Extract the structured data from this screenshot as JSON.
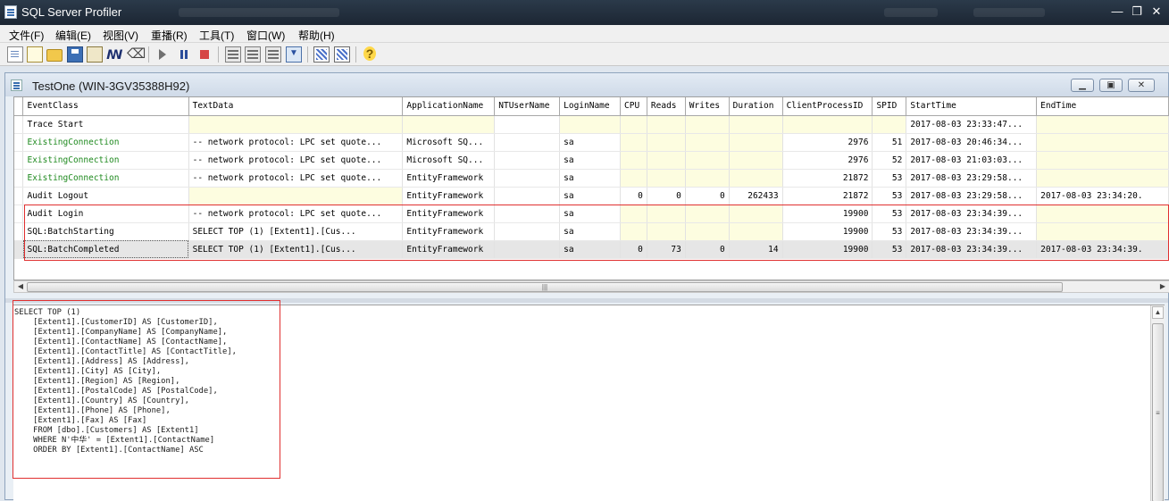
{
  "window": {
    "title": "SQL Server Profiler"
  },
  "menu": [
    "文件(F)",
    "编辑(E)",
    "视图(V)",
    "重播(R)",
    "工具(T)",
    "窗口(W)",
    "帮助(H)"
  ],
  "toolbar": {
    "buttons": [
      "new-trace-icon",
      "new-template-icon",
      "open-folder-icon",
      "save-icon",
      "properties-icon",
      "find-icon",
      "clear-icon",
      "start-icon",
      "pause-icon",
      "stop-icon",
      "grid-icon",
      "grid2-icon",
      "columns-icon",
      "auto-scroll-icon",
      "perfmon-icon",
      "chart-icon",
      "help-icon"
    ]
  },
  "trace_window": {
    "title": "TestOne (WIN-3GV35388H92)",
    "columns": [
      "EventClass",
      "TextData",
      "ApplicationName",
      "NTUserName",
      "LoginName",
      "CPU",
      "Reads",
      "Writes",
      "Duration",
      "ClientProcessID",
      "SPID",
      "StartTime",
      "EndTime"
    ],
    "rows": [
      {
        "EventClass": "Trace Start",
        "TextData": "",
        "ApplicationName": "",
        "NTUserName": "",
        "LoginName": "",
        "CPU": "",
        "Reads": "",
        "Writes": "",
        "Duration": "",
        "ClientProcessID": "",
        "SPID": "",
        "StartTime": "2017-08-03 23:33:47...",
        "EndTime": "",
        "green": false
      },
      {
        "EventClass": "ExistingConnection",
        "TextData": "-- network protocol: LPC  set quote...",
        "ApplicationName": "Microsoft SQ...",
        "NTUserName": "",
        "LoginName": "sa",
        "CPU": "",
        "Reads": "",
        "Writes": "",
        "Duration": "",
        "ClientProcessID": "2976",
        "SPID": "51",
        "StartTime": "2017-08-03 20:46:34...",
        "EndTime": "",
        "green": true
      },
      {
        "EventClass": "ExistingConnection",
        "TextData": "-- network protocol: LPC  set quote...",
        "ApplicationName": "Microsoft SQ...",
        "NTUserName": "",
        "LoginName": "sa",
        "CPU": "",
        "Reads": "",
        "Writes": "",
        "Duration": "",
        "ClientProcessID": "2976",
        "SPID": "52",
        "StartTime": "2017-08-03 21:03:03...",
        "EndTime": "",
        "green": true
      },
      {
        "EventClass": "ExistingConnection",
        "TextData": "-- network protocol: LPC  set quote...",
        "ApplicationName": "EntityFramework",
        "NTUserName": "",
        "LoginName": "sa",
        "CPU": "",
        "Reads": "",
        "Writes": "",
        "Duration": "",
        "ClientProcessID": "21872",
        "SPID": "53",
        "StartTime": "2017-08-03 23:29:58...",
        "EndTime": "",
        "green": true
      },
      {
        "EventClass": "Audit Logout",
        "TextData": "",
        "ApplicationName": "EntityFramework",
        "NTUserName": "",
        "LoginName": "sa",
        "CPU": "0",
        "Reads": "0",
        "Writes": "0",
        "Duration": "262433",
        "ClientProcessID": "21872",
        "SPID": "53",
        "StartTime": "2017-08-03 23:29:58...",
        "EndTime": "2017-08-03 23:34:20.",
        "green": false
      },
      {
        "EventClass": "Audit Login",
        "TextData": "-- network protocol: LPC  set quote...",
        "ApplicationName": "EntityFramework",
        "NTUserName": "",
        "LoginName": "sa",
        "CPU": "",
        "Reads": "",
        "Writes": "",
        "Duration": "",
        "ClientProcessID": "19900",
        "SPID": "53",
        "StartTime": "2017-08-03 23:34:39...",
        "EndTime": "",
        "green": false
      },
      {
        "EventClass": "SQL:BatchStarting",
        "TextData": "SELECT TOP (1)       [Extent1].[Cus...",
        "ApplicationName": "EntityFramework",
        "NTUserName": "",
        "LoginName": "sa",
        "CPU": "",
        "Reads": "",
        "Writes": "",
        "Duration": "",
        "ClientProcessID": "19900",
        "SPID": "53",
        "StartTime": "2017-08-03 23:34:39...",
        "EndTime": "",
        "green": false
      },
      {
        "EventClass": "SQL:BatchCompleted",
        "TextData": "SELECT TOP (1)       [Extent1].[Cus...",
        "ApplicationName": "EntityFramework",
        "NTUserName": "",
        "LoginName": "sa",
        "CPU": "0",
        "Reads": "73",
        "Writes": "0",
        "Duration": "14",
        "ClientProcessID": "19900",
        "SPID": "53",
        "StartTime": "2017-08-03 23:34:39...",
        "EndTime": "2017-08-03 23:34:39.",
        "green": false,
        "selected": true
      }
    ],
    "sql_lines": [
      "SELECT TOP (1)",
      "    [Extent1].[CustomerID] AS [CustomerID],",
      "    [Extent1].[CompanyName] AS [CompanyName],",
      "    [Extent1].[ContactName] AS [ContactName],",
      "    [Extent1].[ContactTitle] AS [ContactTitle],",
      "    [Extent1].[Address] AS [Address],",
      "    [Extent1].[City] AS [City],",
      "    [Extent1].[Region] AS [Region],",
      "    [Extent1].[PostalCode] AS [PostalCode],",
      "    [Extent1].[Country] AS [Country],",
      "    [Extent1].[Phone] AS [Phone],",
      "    [Extent1].[Fax] AS [Fax]",
      "    FROM [dbo].[Customers] AS [Extent1]",
      "    WHERE N'中华' = [Extent1].[ContactName]",
      "    ORDER BY [Extent1].[ContactName] ASC"
    ]
  },
  "colors": {
    "green_text": "#1f8a1f",
    "highlight_cell": "#fdfde0",
    "annotation_red": "#e03030",
    "selected_row": "#e6e6e6"
  }
}
